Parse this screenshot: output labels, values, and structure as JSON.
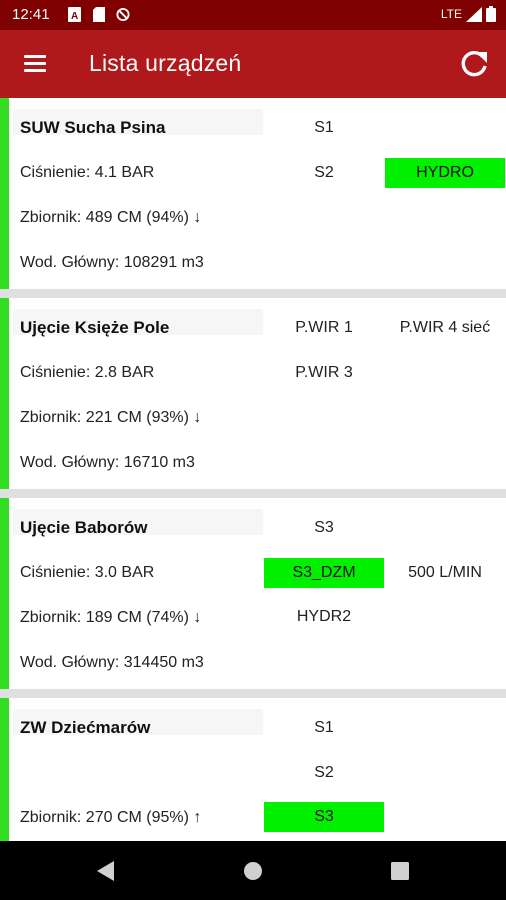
{
  "status": {
    "time": "12:41",
    "network": "LTE"
  },
  "header": {
    "title": "Lista urządzeń"
  },
  "devices": [
    {
      "name": "SUW Sucha Psina",
      "pressure": "Ciśnienie: 4.1 BAR",
      "tank": "Zbiornik: 489 CM (94%) ↓",
      "main_water": "Wod. Główny: 108291 m3",
      "cells": [
        {
          "text": "S1",
          "active": false
        },
        {
          "text": "S2",
          "active": false
        },
        {
          "text": "HYDRO",
          "active": true
        }
      ]
    },
    {
      "name": "Ujęcie Księże Pole",
      "pressure": "Ciśnienie: 2.8 BAR",
      "tank": "Zbiornik: 221 CM (93%) ↓",
      "main_water": "Wod. Główny: 16710 m3",
      "cells": [
        {
          "text": "P.WIR 1",
          "active": false
        },
        {
          "text": "P.WIR 4 sieć",
          "active": false
        },
        {
          "text": "P.WIR 3",
          "active": false
        }
      ]
    },
    {
      "name": "Ujęcie Baborów",
      "pressure": "Ciśnienie: 3.0 BAR",
      "tank": "Zbiornik: 189 CM (74%) ↓",
      "main_water": "Wod. Główny: 314450 m3",
      "cells": [
        {
          "text": "S3",
          "active": false
        },
        {
          "text": "S3_DZM",
          "active": true
        },
        {
          "text": "500 L/MIN",
          "active": false
        },
        {
          "text": "HYDR2",
          "active": false
        }
      ]
    },
    {
      "name": "ZW Dziećmarów",
      "pressure": "",
      "tank": "Zbiornik: 270 CM (95%) ↑",
      "main_water": "",
      "cells": [
        {
          "text": "S1",
          "active": false
        },
        {
          "text": "S2",
          "active": false
        },
        {
          "text": "S3",
          "active": true
        }
      ]
    }
  ],
  "colors": {
    "status_bar": "#7f0000",
    "app_bar": "#b0191b",
    "online_stripe": "#33dd22",
    "active_cell": "#00f000"
  },
  "icons": [
    "sim-card-icon",
    "sd-card-icon",
    "do-not-disturb-icon",
    "signal-icon",
    "battery-icon",
    "menu-icon",
    "refresh-icon",
    "back-icon",
    "home-icon",
    "recents-icon"
  ]
}
